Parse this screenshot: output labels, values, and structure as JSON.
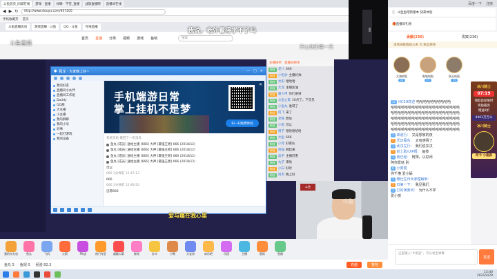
{
  "browser": {
    "tabs": [
      "斗鱼首页_同城在线",
      "游戏 · 直播",
      "绿狮 · 学堂_直播",
      "战旗直播网",
      "直播间在线"
    ],
    "url": "http://www.douyu.com/957205",
    "bookmarks": [
      "手机收藏夹",
      "首页"
    ],
    "inner_tabs": [
      "斗鱼直播房间",
      "游戏直播 · 斗鱼",
      "QQ · 斗鱼",
      "在线直播"
    ],
    "nav_items": [
      "首页",
      "直播",
      "分类",
      "视频",
      "游戏",
      "鱼吧"
    ],
    "search_placeholder": "搜索"
  },
  "captions": {
    "top": "我说，老外看得学不了吗",
    "middle": "爱与痛在我心里",
    "watermark_left": "斗鱼直播",
    "watermark_right": "开心快乐每一天"
  },
  "chat_window": {
    "title": "程龙 · 大家晚上好~",
    "groups": [
      "我的好友",
      "直播间小伙伴",
      "直播间工作组",
      "Daddy",
      "QQ群",
      "大主播",
      "小主播",
      "我的群聊",
      "我的小号",
      "同事",
      "一起打游戏",
      "我的设备"
    ],
    "banner_line1": "手机端游日常",
    "banner_line2": "掌上挂机不是梦",
    "scan_button": "扫一扫免费体验",
    "messages": [
      "系统消息 撤回了一条消息",
      "鱼丸 [成员] 送给主播 [666] 大神 [最强王者] 666 (2018/12)",
      "鱼丸 [成员] 送给主播 [666] 大神 [最强王者] 666 (2018/12)",
      "鱼丸 [成员] 送给主播 [666] 大神 [最强王者] 666 (2018/12)",
      "鱼丸 [成员] 送给主播 [666] 大神 [最强王者] 666 (2018/12)",
      "可以",
      "666 3分钟前 12:47:13",
      "666",
      "666 2分钟前 12:48:50",
      "迅哥666"
    ]
  },
  "overlay_chat": {
    "header": [
      "主播榜单",
      "直播间榜单"
    ],
    "rows": [
      {
        "badge": "粉丝",
        "name": "老八",
        "text": "666"
      },
      {
        "badge": "粉丝",
        "name": "小毛驴",
        "text": "主播好帅"
      },
      {
        "badge": "粉丝",
        "name": "太阳",
        "text": "哈哈哈"
      },
      {
        "badge": "粉丝",
        "name": "大龙",
        "text": "主播加油"
      },
      {
        "badge": "粉丝",
        "name": "路人甲",
        "text": "你们讲讲"
      },
      {
        "badge": "粉丝",
        "name": "斗鱼之家",
        "text": "10点了，下次见"
      },
      {
        "badge": "粉丝",
        "name": "小鱼丸",
        "text": "谁得了"
      },
      {
        "badge": "粉丝",
        "name": "阿飞",
        "text": "来了"
      },
      {
        "badge": "粉丝",
        "name": "老铁",
        "text": "稳住"
      },
      {
        "badge": "粉丝",
        "name": "小黑",
        "text": "可以"
      },
      {
        "badge": "粉丝",
        "name": "橙子",
        "text": "哈哈哈哈哈"
      },
      {
        "badge": "粉丝",
        "name": "大鱼",
        "text": "666"
      },
      {
        "badge": "粉丝",
        "name": "小月",
        "text": "好家伙"
      },
      {
        "badge": "粉丝",
        "name": "阿强",
        "text": "刷起来"
      },
      {
        "badge": "粉丝",
        "name": "高手",
        "text": "主播厉害"
      },
      {
        "badge": "粉丝",
        "name": "丸子",
        "text": "来啦"
      },
      {
        "badge": "粉丝",
        "name": "小白",
        "text": "好听"
      },
      {
        "badge": "粉丝",
        "name": "阿杰",
        "text": "晚上好"
      }
    ]
  },
  "right_panel": {
    "topstrip": [
      "百度一下",
      "注册"
    ],
    "version_text": "斗鱼鱼吧新版本 快来体验",
    "gift_text": "直播间礼物",
    "share_tabs": [
      "贡献(236)",
      "贵宾(236)"
    ],
    "note": "本场贡献值前三名 为 粉丝榜单",
    "ranks": [
      {
        "name": "大海的鱼",
        "level": "23"
      },
      {
        "name": "啦啦啦啦",
        "level": "17"
      },
      {
        "name": "秋天的雨",
        "level": "15"
      }
    ],
    "promo": {
      "title": "冰川骑士",
      "timer": "07:19",
      "lines": [
        "领取首轮限时",
        "奖励最高",
        "赠送8折"
      ],
      "price": "4461万万斗",
      "label2": "冰川骑士",
      "level_text": "阿卡 小鹿森"
    },
    "chat": [
      {
        "lv": "17",
        "user": "HCSH欢迎",
        "text": "哈哈哈哈哈哈哈哈哈哈"
      },
      {
        "lv": "",
        "user": "",
        "text": "哈哈哈哈哈哈哈哈哈哈哈哈哈哈哈哈哈哈哈哈"
      },
      {
        "lv": "",
        "user": "",
        "text": "哈哈哈哈哈哈哈哈哈哈哈哈哈哈哈哈哈哈哈哈"
      },
      {
        "lv": "",
        "user": "",
        "text": "哈哈哈哈哈哈哈哈哈哈哈哈哈哈哈哈哈哈哈哈"
      },
      {
        "lv": "",
        "user": "",
        "text": "哈哈哈哈哈哈哈哈哈哈哈哈哈哈哈哈哈哈哈哈"
      },
      {
        "lv": "",
        "user": "",
        "text": "哈哈哈哈哈哈哈哈哈哈哈哈哈哈哈哈哈哈哈哈"
      },
      {
        "lv": "7",
        "user": "单道行：",
        "text": "又是想家的夜"
      },
      {
        "lv": "7",
        "user": "式识程东：",
        "text": "太有感情了"
      },
      {
        "lv": "7",
        "user": "武汉左行：",
        "text": "我们说东汉"
      },
      {
        "lv": "7",
        "user": "前上耿/UIP绸：",
        "text": "画技"
      },
      {
        "lv": "7",
        "user": "我已经：",
        "text": "阿阳，以好闭"
      },
      {
        "lv": "",
        "user": "",
        "text": "阿你爱哒 别"
      },
      {
        "lv": "6",
        "user": "小麦丽",
        "text": ""
      },
      {
        "lv": "",
        "user": "",
        "text": "你千懂 爱小舔"
      },
      {
        "lv": "7",
        "user": "哪仕生日大家理解到：",
        "text": ""
      },
      {
        "lv": "7",
        "user": "日第一下：",
        "text": "我见我们"
      },
      {
        "lv": "7",
        "user": "打的演奏问：",
        "text": "为什么不学"
      },
      {
        "lv": "",
        "user": "",
        "text": "爱小孩"
      }
    ],
    "input_placeholder": "这里输入“#发送”，可以发出弹幕",
    "send_label": "发送",
    "clock_time": "13:40",
    "clock_date": "2021/4/29"
  },
  "gift_bar": {
    "items": [
      "我的大礼包",
      "鱼丸",
      "飞机",
      "火箭",
      "PK战",
      "热门专区",
      "超级火箭",
      "鲜花",
      "办卡",
      "小熊",
      "大宝剑",
      "欢乐吧",
      "乐团",
      "主播",
      "星际",
      "鱼翅"
    ],
    "colors": [
      "#f2a238",
      "#ff73a6",
      "#7aa6f0",
      "#ff6b3a",
      "#c94fe0",
      "#ff9b2d",
      "#ff4d4d",
      "#ff7ec6",
      "#f5c542",
      "#e08a4a",
      "#6f8af0",
      "#ffb84a",
      "#d36cf0",
      "#4ab8e0",
      "#ff8e3c",
      "#66c88a"
    ]
  },
  "bottom_bar": {
    "items": [
      "鱼丸 5",
      "鱼翅 0",
      "经验 82.3"
    ],
    "btn1": "充值",
    "btn2": "背包"
  }
}
